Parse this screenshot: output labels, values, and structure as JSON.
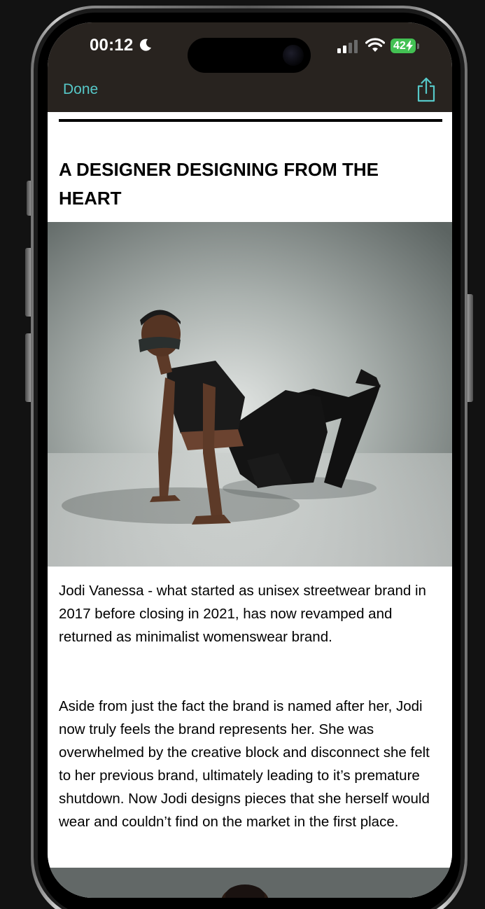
{
  "status_bar": {
    "time": "00:12",
    "battery_level": "42",
    "icons": [
      "moon-icon",
      "cellular-signal-icon",
      "wifi-icon",
      "battery-icon",
      "charging-bolt-icon"
    ]
  },
  "nav": {
    "done_label": "Done",
    "share_icon": "share-icon",
    "accent_color": "#56c8c8",
    "bar_color": "#28231f"
  },
  "article": {
    "headline": "A DESIGNER DESIGNING FROM THE HEART",
    "paragraphs": [
      "Jodi Vanessa - what started as unisex streetwear brand in 2017 before closing in 2021, has now revamped and returned as minimalist womenswear brand.",
      "Aside from just the fact the brand is named after her, Jodi now truly feels the brand represents her. She was overwhelmed by the creative block and disconnect she felt to her previous brand, ultimately leading to it’s premature shutdown. Now Jodi designs pieces that she herself would wear and couldn’t find on the market in the first place."
    ]
  },
  "battery_color": "#43c153"
}
